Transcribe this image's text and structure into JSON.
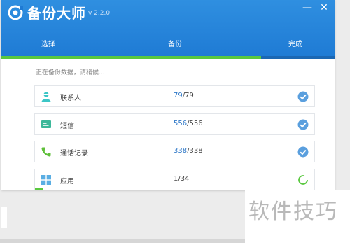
{
  "app": {
    "title": "备份大师",
    "version": "v 2.2.0"
  },
  "window_controls": {
    "minimize_label": "—",
    "close_label": "✕"
  },
  "tabs": [
    {
      "label": "选择"
    },
    {
      "label": "备份"
    },
    {
      "label": "完成"
    }
  ],
  "overall_progress_fraction": 0.78,
  "status_text": "正在备份数据，请稍候...",
  "items": [
    {
      "label": "联系人",
      "done": "79",
      "total": "/79",
      "icon": "contact-icon",
      "status": "done"
    },
    {
      "label": "短信",
      "done": "556",
      "total": "/556",
      "icon": "message-icon",
      "status": "done"
    },
    {
      "label": "通话记录",
      "done": "338",
      "total": "/338",
      "icon": "phone-icon",
      "status": "done"
    },
    {
      "label": "应用",
      "done": "1",
      "total": "/34",
      "icon": "apps-icon",
      "status": "in-progress",
      "progress_fraction": 0.03
    }
  ],
  "watermark": "软件技巧",
  "colors": {
    "header": "#1e7ad4",
    "accent_green": "#59c83f",
    "check_blue": "#5a9fde",
    "contact_teal": "#3cc6c6"
  }
}
